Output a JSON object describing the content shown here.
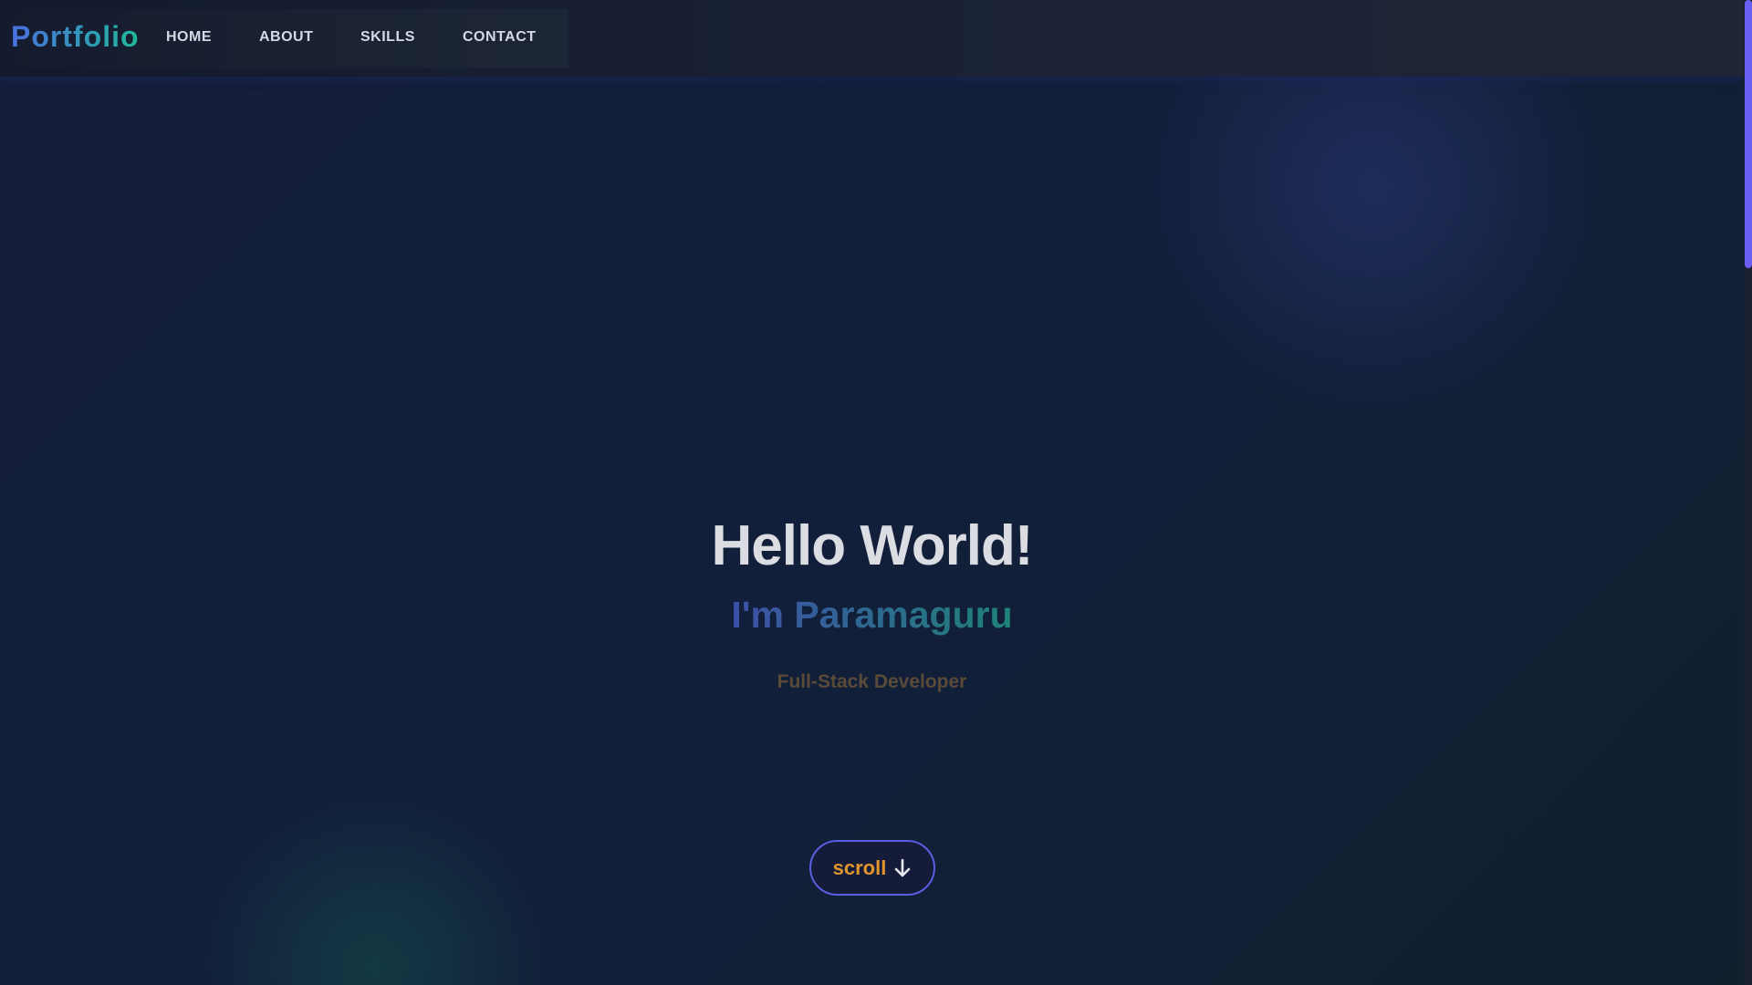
{
  "nav": {
    "logo": "Portfolio",
    "links": [
      "HOME",
      "ABOUT",
      "SKILLS",
      "CONTACT"
    ]
  },
  "hero": {
    "greeting": "Hello World!",
    "name": "I'm Paramaguru",
    "role": "Full-Stack Developer",
    "scroll_label": "scroll"
  },
  "colors": {
    "accent": "#6366f1",
    "scroll_text": "#e0962a",
    "role_text": "#5a4b38"
  }
}
